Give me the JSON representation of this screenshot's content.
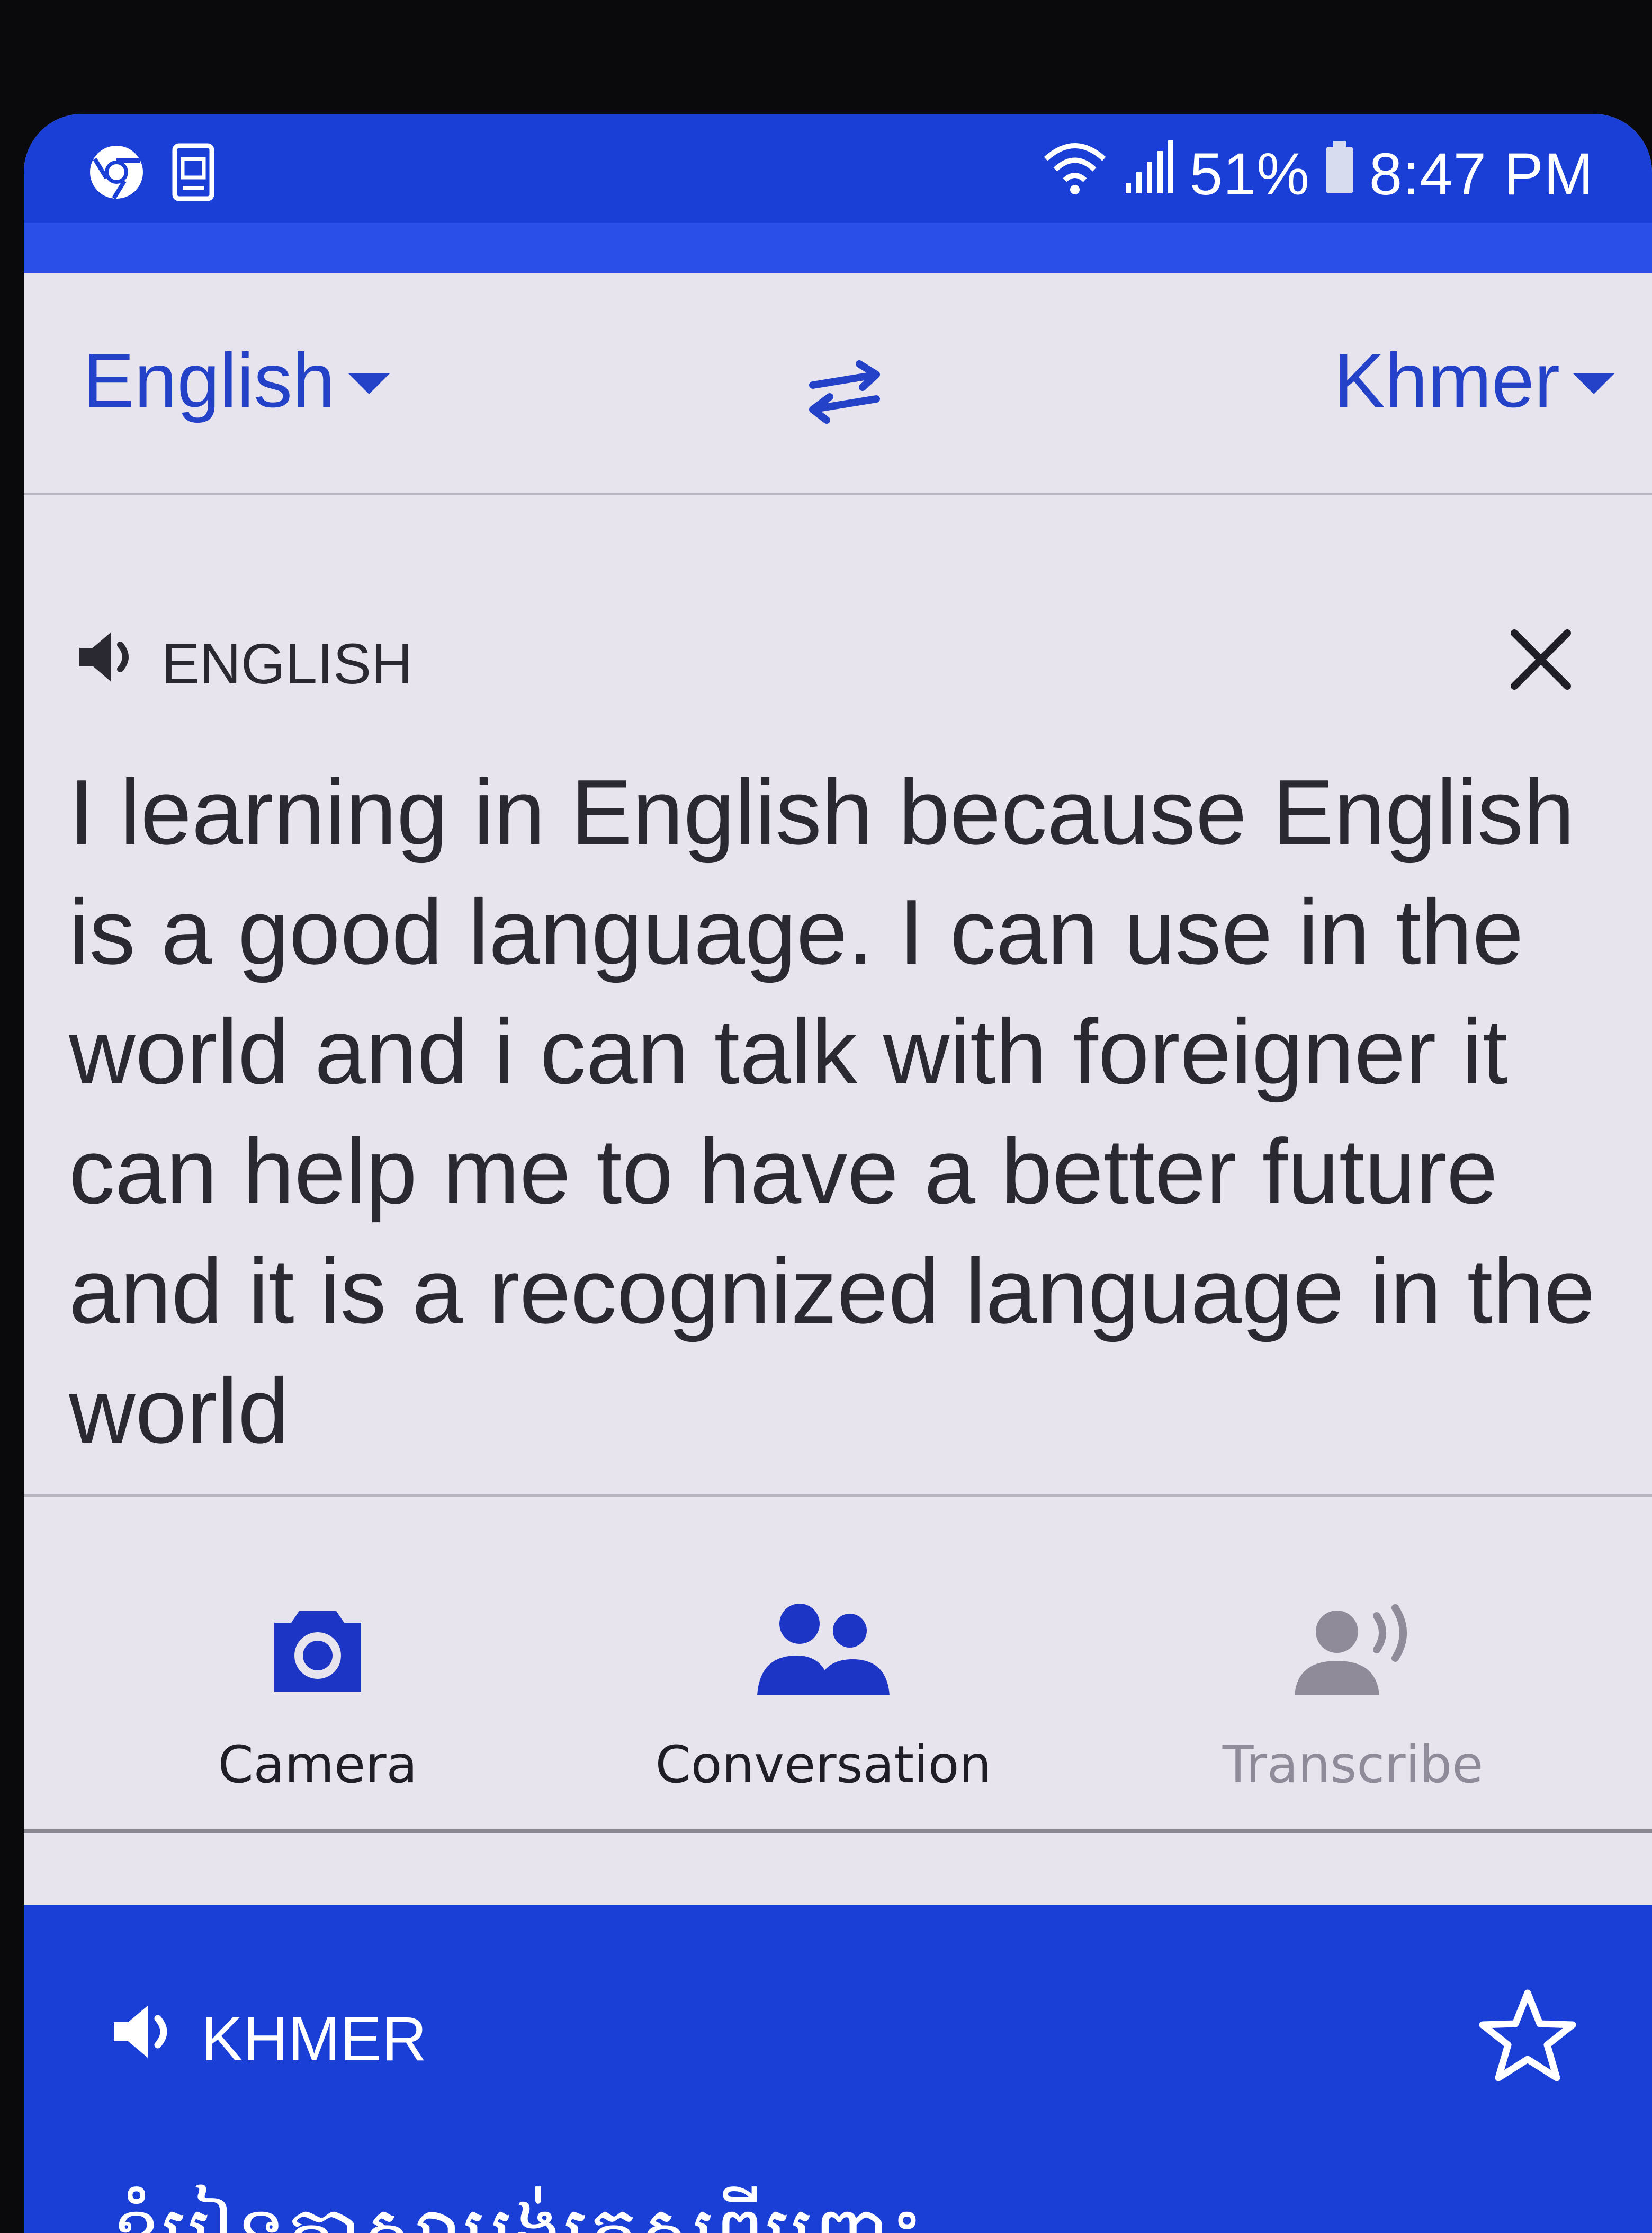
{
  "status_bar": {
    "battery": "51%",
    "time": "8:47 PM",
    "icons": [
      "chrome-icon",
      "sim-card-icon",
      "wifi-icon",
      "signal-icon",
      "battery-icon"
    ]
  },
  "languages": {
    "source": "English",
    "target": "Khmer"
  },
  "input": {
    "label": "ENGLISH",
    "text": "I learning in English because English is a good language. I can use in the world and i can talk with foreigner it can help me to have a better future and  it is a recognized language in the world"
  },
  "actions": [
    {
      "label": "Camera",
      "icon": "camera-icon"
    },
    {
      "label": "Conversation",
      "icon": "people-icon"
    },
    {
      "label": "Transcribe",
      "icon": "transcribe-icon",
      "disabled": true
    }
  ],
  "output": {
    "label": "KHMER",
    "text": "ខ្ញុំរៀនភាសាអង់គ្លេសពីព្រោះ"
  },
  "colors": {
    "primary_blue": "#1a3fd6",
    "link_blue": "#2342c8",
    "background": "#e8e4ee",
    "text_dark": "#2a2830",
    "disabled_gray": "#8f8b98"
  }
}
